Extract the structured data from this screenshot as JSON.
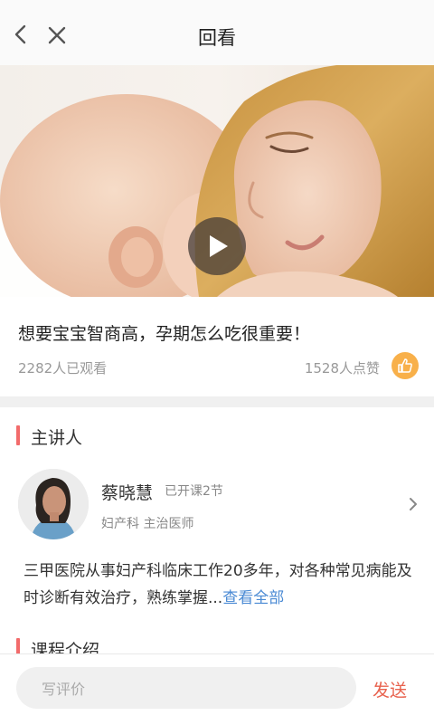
{
  "header": {
    "title": "回看",
    "back_icon": "chevron-left-icon",
    "close_icon": "close-icon"
  },
  "video": {
    "play_icon": "play-icon"
  },
  "course": {
    "title": "想要宝宝智商高，孕期怎么吃很重要！",
    "views": "2282人已观看",
    "likes": "1528人点赞",
    "like_icon": "thumbs-up-icon"
  },
  "lecturer_section": {
    "heading": "主讲人",
    "name": "蔡晓慧",
    "course_count": "已开课2节",
    "department": "妇产科  主治医师",
    "bio": "三甲医院从事妇产科临床工作20多年，对各种常见病能及时诊断有效治疗，熟练掌握...",
    "more_link": "查看全部"
  },
  "intro_section": {
    "heading": "课程介绍"
  },
  "footer": {
    "comment_placeholder": "写评价",
    "send_label": "发送"
  },
  "colors": {
    "accent_red": "#e8624e",
    "section_bar": "#f26b6b",
    "link_blue": "#4a8ad4",
    "like_orange": "#f8b04a"
  }
}
